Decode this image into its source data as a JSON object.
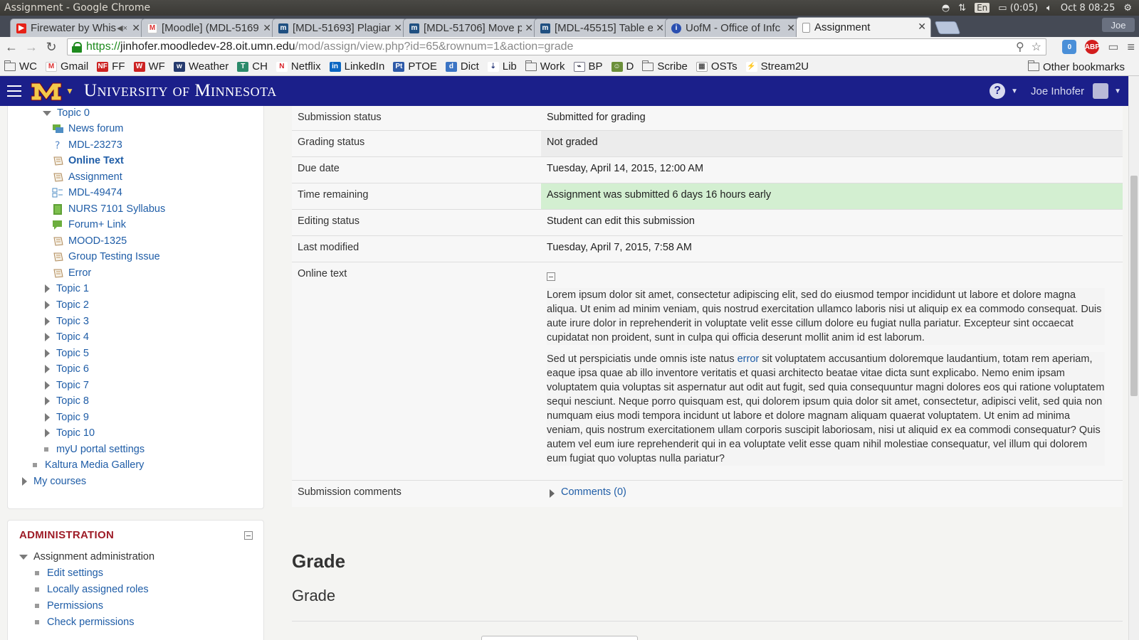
{
  "os": {
    "window_title": "Assignment - Google Chrome",
    "lang": "En",
    "battery": "(0:05)",
    "datetime": "Oct 8 08:25",
    "user": "Joe"
  },
  "tabs": [
    {
      "label": "Firewater by Whis",
      "fav": "yt",
      "muted": true
    },
    {
      "label": "[Moodle] (MDL-5169",
      "fav": "gmail"
    },
    {
      "label": "[MDL-51693] Plagiar",
      "fav": "jira"
    },
    {
      "label": "[MDL-51706] Move p",
      "fav": "jira"
    },
    {
      "label": "[MDL-45515] Table e",
      "fav": "jira"
    },
    {
      "label": "UofM - Office of Infc",
      "fav": "umn"
    },
    {
      "label": "Assignment",
      "fav": "page",
      "active": true
    }
  ],
  "url": {
    "scheme": "https://",
    "host": "jinhofer.moodledev-28.oit.umn.edu",
    "path": "/mod/assign/view.php?id=65&rownum=1&action=grade"
  },
  "bookmarks": [
    {
      "label": "WC",
      "icon": "folder"
    },
    {
      "label": "Gmail",
      "icon": "gmail"
    },
    {
      "label": "FF",
      "icon": "ff"
    },
    {
      "label": "WF",
      "icon": "wf"
    },
    {
      "label": "Weather",
      "icon": "weather"
    },
    {
      "label": "CH",
      "icon": "ch"
    },
    {
      "label": "Netflix",
      "icon": "netflix"
    },
    {
      "label": "LinkedIn",
      "icon": "linkedin"
    },
    {
      "label": "PTOE",
      "icon": "ptoe"
    },
    {
      "label": "Dict",
      "icon": "dict"
    },
    {
      "label": "Lib",
      "icon": "lib"
    },
    {
      "label": "Work",
      "icon": "folder"
    },
    {
      "label": "BP",
      "icon": "bp"
    },
    {
      "label": "D",
      "icon": "d"
    },
    {
      "label": "Scribe",
      "icon": "folder"
    },
    {
      "label": "OSTs",
      "icon": "osts"
    },
    {
      "label": "Stream2U",
      "icon": "stream"
    }
  ],
  "bookmarks_other": "Other bookmarks",
  "header": {
    "site_name": "University of Minnesota",
    "user_name": "Joe Inhofer"
  },
  "nav": {
    "topic0": "Topic 0",
    "activities": [
      {
        "label": "News forum",
        "icon": "forum-icon"
      },
      {
        "label": "MDL-23273",
        "icon": "quiz-icon"
      },
      {
        "label": "Online Text",
        "icon": "assign-icon",
        "current": true
      },
      {
        "label": "Assignment",
        "icon": "assign-icon"
      },
      {
        "label": "MDL-49474",
        "icon": "feedback-icon"
      },
      {
        "label": "NURS 7101 Syllabus",
        "icon": "book-icon"
      },
      {
        "label": "Forum+ Link",
        "icon": "forum-plus-icon"
      },
      {
        "label": "MOOD-1325",
        "icon": "assign-icon"
      },
      {
        "label": "Group Testing Issue",
        "icon": "assign-icon"
      },
      {
        "label": "Error",
        "icon": "assign-icon"
      }
    ],
    "topics": [
      "Topic 1",
      "Topic 2",
      "Topic 3",
      "Topic 4",
      "Topic 5",
      "Topic 6",
      "Topic 7",
      "Topic 8",
      "Topic 9",
      "Topic 10"
    ],
    "portal": "myU portal settings",
    "kaltura": "Kaltura Media Gallery",
    "my_courses": "My courses"
  },
  "admin": {
    "title": "ADMINISTRATION",
    "section": "Assignment administration",
    "items": [
      "Edit settings",
      "Locally assigned roles",
      "Permissions",
      "Check permissions"
    ]
  },
  "submission": {
    "rows": [
      {
        "label": "Submission status",
        "value": "Submitted for grading"
      },
      {
        "label": "Grading status",
        "value": "Not graded"
      },
      {
        "label": "Due date",
        "value": "Tuesday, April 14, 2015, 12:00 AM"
      },
      {
        "label": "Time remaining",
        "value": "Assignment was submitted 6 days 16 hours early"
      },
      {
        "label": "Editing status",
        "value": "Student can edit this submission"
      },
      {
        "label": "Last modified",
        "value": "Tuesday, April 7, 2015, 7:58 AM"
      }
    ],
    "online_text_label": "Online text",
    "para1": "Lorem ipsum dolor sit amet, consectetur adipiscing elit, sed do eiusmod tempor incididunt ut labore et dolore magna aliqua. Ut enim ad minim veniam, quis nostrud exercitation ullamco laboris nisi ut aliquip ex ea commodo consequat. Duis aute irure dolor in reprehenderit in voluptate velit esse cillum dolore eu fugiat nulla pariatur. Excepteur sint occaecat cupidatat non proident, sunt in culpa qui officia deserunt mollit anim id est laborum.",
    "para2_before": "Sed ut perspiciatis unde omnis iste natus ",
    "para2_link": "error",
    "para2_after": " sit voluptatem accusantium doloremque laudantium, totam rem aperiam, eaque ipsa quae ab illo inventore veritatis et quasi architecto beatae vitae dicta sunt explicabo. Nemo enim ipsam voluptatem quia voluptas sit aspernatur aut odit aut fugit, sed quia consequuntur magni dolores eos qui ratione voluptatem sequi nesciunt. Neque porro quisquam est, qui dolorem ipsum quia dolor sit amet, consectetur, adipisci velit, sed quia non numquam eius modi tempora incidunt ut labore et dolore magnam aliquam quaerat voluptatem. Ut enim ad minima veniam, quis nostrum exercitationem ullam corporis suscipit laboriosam, nisi ut aliquid ex ea commodi consequatur? Quis autem vel eum iure reprehenderit qui in ea voluptate velit esse quam nihil molestiae consequatur, vel illum qui dolorem eum fugiat quo voluptas nulla pariatur?",
    "comments_label": "Submission comments",
    "comments_link": "Comments (0)"
  },
  "grade": {
    "heading1": "Grade",
    "heading2": "Grade"
  },
  "colors": {
    "header_bg": "#1b1f8a",
    "link": "#1f5da7",
    "admin_title": "#9e1c27",
    "green_row": "#d3efd1",
    "red_text": "#e1201e"
  }
}
